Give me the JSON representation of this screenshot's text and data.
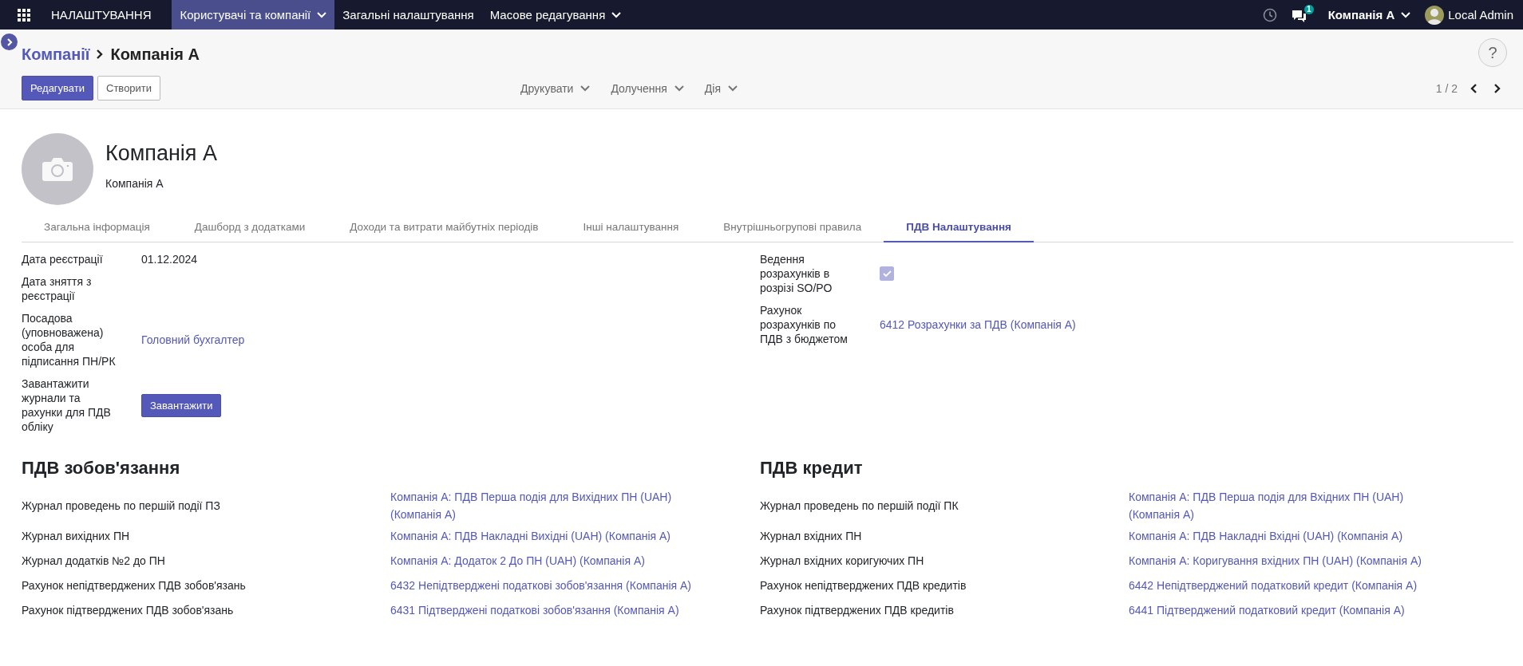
{
  "navbar": {
    "app_title": "НАЛАШТУВАННЯ",
    "menus": [
      {
        "label": "Користувачі та компанії",
        "selected": true,
        "dropdown": true
      },
      {
        "label": "Загальні налаштування",
        "selected": false,
        "dropdown": false
      },
      {
        "label": "Масове редагування",
        "selected": false,
        "dropdown": true
      }
    ],
    "chat_badge": "1",
    "company": "Компанія А",
    "user": "Local Admin"
  },
  "control_panel": {
    "breadcrumb": [
      {
        "label": "Компанії",
        "kind": "link"
      },
      {
        "label": "Компанія А",
        "kind": "current"
      }
    ],
    "buttons": [
      {
        "label": "Редагувати",
        "kind": "primary"
      },
      {
        "label": "Створити",
        "kind": "secondary"
      }
    ],
    "actions": [
      "Друкувати",
      "Долучення",
      "Дія"
    ],
    "help": "?",
    "pager": "1 / 2"
  },
  "form": {
    "title": "Компанія А",
    "subtitle": "Компанія А",
    "tabs": [
      {
        "label": "Загальна інформація",
        "selected": false
      },
      {
        "label": "Дашборд з додатками",
        "selected": false
      },
      {
        "label": "Доходи та витрати майбутніх періодів",
        "selected": false
      },
      {
        "label": "Інші налаштування",
        "selected": false
      },
      {
        "label": "Внутрішньогрупові правила",
        "selected": false
      },
      {
        "label": "ПДВ Налаштування",
        "selected": true
      }
    ],
    "left_fields": [
      {
        "label": "Дата реєстрації",
        "kind": "text",
        "value": "01.12.2024"
      },
      {
        "label": "Дата зняття з реєстрації",
        "kind": "empty"
      },
      {
        "label": "Посадова (уповноважена) особа для підписання ПН/РК",
        "kind": "link",
        "value": "Головний бухгалтер"
      },
      {
        "label": "Завантажити журнали та рахунки для ПДВ обліку",
        "kind": "button",
        "value": "Завантажити"
      }
    ],
    "right_fields": [
      {
        "label": "Ведення розрахунків в розрізі SO/PO",
        "kind": "checkbox",
        "checked": true,
        "disabled": true
      },
      {
        "label": "Рахунок розрахунків по ПДВ з бюджетом",
        "kind": "link",
        "value": "6412 Розрахунки за ПДВ (Компанія А)"
      }
    ],
    "sections": [
      {
        "title": "ПДВ зобов'язання",
        "rows": [
          {
            "label": "Журнал проведень по першій події ПЗ",
            "value": "Компанія А: ПДВ Перша подія для Вихідних ПН (UAH) (Компанія А)"
          },
          {
            "label": "Журнал вихідних ПН",
            "value": "Компанія А: ПДВ Накладні Вихідні (UAH) (Компанія А)"
          },
          {
            "label": "Журнал додатків №2 до ПН",
            "value": "Компанія А: Додаток 2 До ПН (UAH) (Компанія А)"
          },
          {
            "label": "Рахунок непідтверджених ПДВ зобов'язань",
            "value": "6432 Непідтверджені податкові зобов'язання (Компанія А)"
          },
          {
            "label": "Рахунок підтверджених ПДВ зобов'язань",
            "value": "6431 Підтверджені податкові зобов'язання (Компанія А)"
          }
        ]
      },
      {
        "title": "ПДВ кредит",
        "rows": [
          {
            "label": "Журнал проведень по першій події ПК",
            "value": "Компанія А: ПДВ Перша подія для Вхідних ПН (UAH) (Компанія А)"
          },
          {
            "label": "Журнал вхідних ПН",
            "value": "Компанія А: ПДВ Накладні Вхідні (UAH) (Компанія А)"
          },
          {
            "label": "Журнал вхідних коригуючих ПН",
            "value": "Компанія А: Коригування вхідних ПН (UAH) (Компанія А)"
          },
          {
            "label": "Рахунок непідтверджених ПДВ кредитів",
            "value": "6442 Непідтверджений податковий кредит (Компанія А)"
          },
          {
            "label": "Рахунок підтверджених ПДВ кредитів",
            "value": "6441 Підтверджений податковий кредит (Компанія А)"
          }
        ]
      }
    ]
  }
}
